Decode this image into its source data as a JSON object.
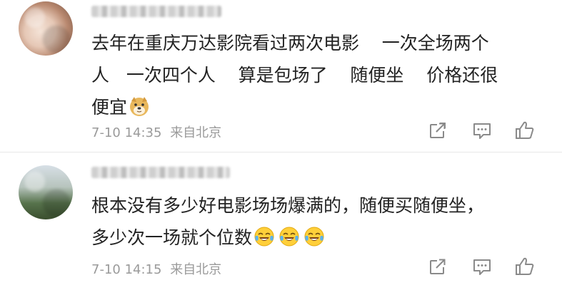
{
  "comments": [
    {
      "username": "",
      "text_lines": [
        "去年在重庆万达影院看过两次电影    一次全场两个",
        "人   一次四个人    算是包场了    随便坐    价格还很",
        "便宜"
      ],
      "emoji": [
        "doge-emoji"
      ],
      "date": "7-10 14:35",
      "location": "来自北京",
      "icons": [
        "share-icon",
        "comment-icon",
        "like-icon"
      ]
    },
    {
      "username": "",
      "text_lines": [
        "根本没有多少好电影场场爆满的，随便买随便坐，",
        "多少次一场就个位数"
      ],
      "emoji": [
        "laugh-cry-emoji",
        "laugh-cry-emoji",
        "laugh-cry-emoji"
      ],
      "date": "7-10 14:15",
      "location": "来自北京",
      "icons": [
        "share-icon",
        "comment-icon",
        "like-icon"
      ]
    }
  ],
  "colors": {
    "text": "#222222",
    "meta": "#9a9a9a",
    "icon": "#8a8a8a",
    "divider": "#e8e8e8"
  }
}
